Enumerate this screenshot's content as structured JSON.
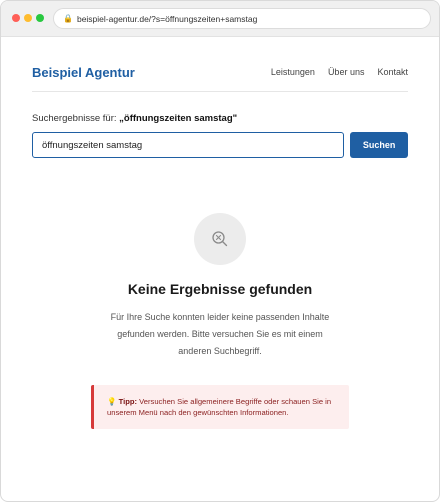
{
  "browser": {
    "url": "beispiel-agentur.de/?s=öffnungszeiten+samstag"
  },
  "header": {
    "brand": "Beispiel Agentur",
    "nav": [
      "Leistungen",
      "Über uns",
      "Kontakt"
    ]
  },
  "search": {
    "results_prefix": "Suchergebnisse für:",
    "query_display": "„öffnungszeiten samstag\"",
    "input_value": "öffnungszeiten samstag",
    "button_label": "Suchen"
  },
  "empty_state": {
    "icon": "search-x-icon",
    "title": "Keine Ergebnisse gefunden",
    "text": "Für Ihre Suche konnten leider keine passenden Inhalte gefunden werden. Bitte versuchen Sie es mit einem anderen Suchbegriff."
  },
  "tip": {
    "icon": "lightbulb-icon",
    "label": "Tipp:",
    "text": "Versuchen Sie allgemeinere Begriffe oder schauen Sie in unserem Menü nach den gewünschten Informationen."
  },
  "colors": {
    "brand": "#1f5fa3",
    "tip_bg": "#fdeeee",
    "tip_border": "#d63a3a"
  }
}
